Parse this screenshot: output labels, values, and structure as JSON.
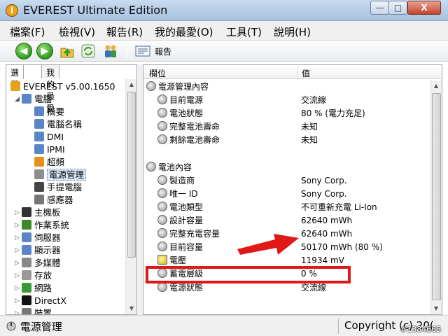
{
  "window": {
    "title": "EVEREST Ultimate Edition",
    "app_icon_glyph": "i",
    "min_glyph": "—",
    "max_glyph": "□",
    "close_glyph": "X"
  },
  "menu": [
    "檔案(F)",
    "檢視(V)",
    "報告(R)",
    "我的最愛(O)",
    "工具(T)",
    "說明(H)"
  ],
  "toolbar": {
    "back_glyph": "◀",
    "forward_glyph": "▶",
    "report_label": "報告"
  },
  "left_tabs": [
    "選單",
    "我的最愛"
  ],
  "tree": [
    {
      "label": "EVEREST v5.00.1650",
      "depth": 0,
      "icon": "everest-info-icon",
      "color": "#e8a21a"
    },
    {
      "label": "電腦",
      "depth": 1,
      "icon": "computer-icon",
      "color": "#5a86c8",
      "exp": "◢"
    },
    {
      "label": "摘要",
      "depth": 2,
      "icon": "summary-icon",
      "color": "#5a86c8"
    },
    {
      "label": "電腦名稱",
      "depth": 2,
      "icon": "computer-name-icon",
      "color": "#5a86c8"
    },
    {
      "label": "DMI",
      "depth": 2,
      "icon": "dmi-icon",
      "color": "#5a86c8"
    },
    {
      "label": "IPMI",
      "depth": 2,
      "icon": "ipmi-icon",
      "color": "#5a86c8"
    },
    {
      "label": "超頻",
      "depth": 2,
      "icon": "overclock-icon",
      "color": "#e8901a"
    },
    {
      "label": "電源管理",
      "depth": 2,
      "icon": "power-management-icon",
      "color": "#8e8e8e",
      "selected": true
    },
    {
      "label": "手提電腦",
      "depth": 2,
      "icon": "laptop-icon",
      "color": "#444444"
    },
    {
      "label": "感應器",
      "depth": 2,
      "icon": "sensor-icon",
      "color": "#777777"
    },
    {
      "label": "主機板",
      "depth": 1,
      "icon": "motherboard-icon",
      "color": "#333333",
      "exp": "▷"
    },
    {
      "label": "作業系統",
      "depth": 1,
      "icon": "windows-icon",
      "color": "#3a8a2a",
      "exp": "▷"
    },
    {
      "label": "伺服器",
      "depth": 1,
      "icon": "server-icon",
      "color": "#5a86c8",
      "exp": "▷"
    },
    {
      "label": "顯示器",
      "depth": 1,
      "icon": "display-icon",
      "color": "#5a86c8",
      "exp": "▷"
    },
    {
      "label": "多媒體",
      "depth": 1,
      "icon": "multimedia-icon",
      "color": "#888888",
      "exp": "▷"
    },
    {
      "label": "存放",
      "depth": 1,
      "icon": "storage-icon",
      "color": "#999999",
      "exp": "▷"
    },
    {
      "label": "網路",
      "depth": 1,
      "icon": "network-icon",
      "color": "#3a9a3a",
      "exp": "▷"
    },
    {
      "label": "DirectX",
      "depth": 1,
      "icon": "directx-icon",
      "color": "#111111",
      "exp": "▷"
    },
    {
      "label": "裝置",
      "depth": 1,
      "icon": "devices-icon",
      "color": "#777777",
      "exp": "▷"
    }
  ],
  "columns": {
    "field": "欄位",
    "value": "值"
  },
  "rows": [
    {
      "field": "電源管理內容",
      "value": "",
      "group": true
    },
    {
      "field": "目前電源",
      "value": "交流線"
    },
    {
      "field": "電池狀態",
      "value": "80 % (電力充足)"
    },
    {
      "field": "完整電池壽命",
      "value": "未知"
    },
    {
      "field": "剩餘電池壽命",
      "value": "未知"
    },
    {
      "field": "",
      "value": "",
      "blank": true
    },
    {
      "field": "電池內容",
      "value": "",
      "group": true
    },
    {
      "field": "製造商",
      "value": "Sony Corp."
    },
    {
      "field": "唯一 ID",
      "value": "Sony Corp."
    },
    {
      "field": "電池類型",
      "value": "不可重新充電 Li-Ion"
    },
    {
      "field": "設計容量",
      "value": "62640 mWh"
    },
    {
      "field": "完整充電容量",
      "value": "62640 mWh"
    },
    {
      "field": "目前容量",
      "value": "50170 mWh  (80 %)"
    },
    {
      "field": "電壓",
      "value": "11934 mV",
      "warn": true
    },
    {
      "field": "蓄電層級",
      "value": "0 %"
    },
    {
      "field": "電源狀態",
      "value": "交流線"
    }
  ],
  "status": {
    "left": "電源管理",
    "right": "Copyright (c) 20("
  },
  "watermark": "#1384665",
  "colors": {
    "highlight": "#e01818",
    "selection": "#dbe8f8",
    "accent": "#2e9a1e"
  }
}
